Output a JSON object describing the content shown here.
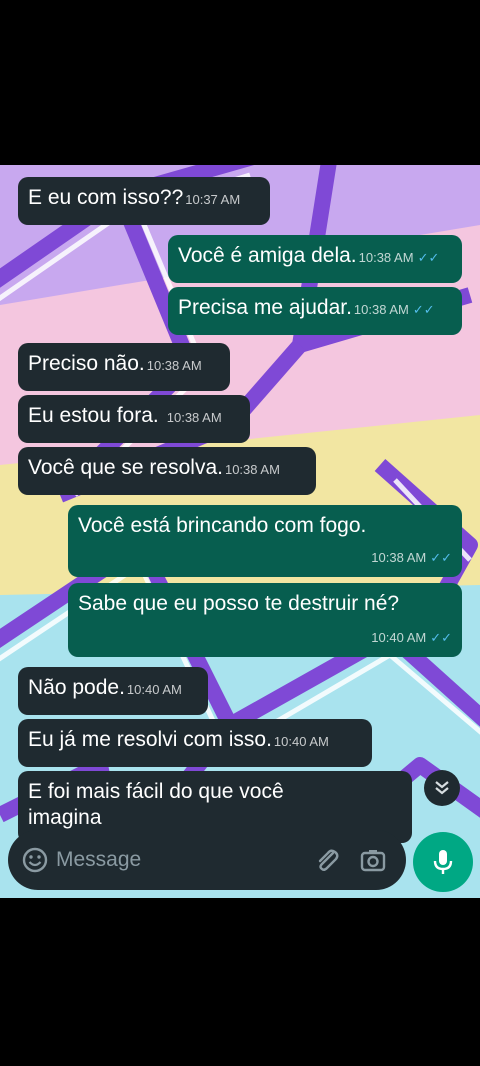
{
  "messages": [
    {
      "text": "E eu com isso??",
      "time": "10:37 AM"
    },
    {
      "text": "Você é amiga dela.",
      "time": "10:38 AM"
    },
    {
      "text": "Precisa me ajudar.",
      "time": "10:38 AM"
    },
    {
      "text": "Preciso não.",
      "time": "10:38 AM"
    },
    {
      "text": "Eu estou fora.",
      "time": "10:38 AM"
    },
    {
      "text": "Você que se resolva.",
      "time": "10:38 AM"
    },
    {
      "text": "Você está brincando com fogo.",
      "time": "10:38 AM"
    },
    {
      "text": "Sabe que eu posso te destruir né?",
      "time": "10:40 AM"
    },
    {
      "text": "Não pode.",
      "time": "10:40 AM"
    },
    {
      "text": "Eu já me resolvi com isso.",
      "time": "10:40 AM"
    },
    {
      "text": "E foi mais fácil do que você",
      "line2": "imagina"
    }
  ],
  "input": {
    "placeholder": "Message"
  },
  "icons": [
    "emoji-icon",
    "attach-icon",
    "camera-icon",
    "mic-icon",
    "chevron-double-down-icon",
    "double-check-icon"
  ],
  "colors": {
    "incoming": "#1f2a30",
    "outgoing": "#075e4f",
    "read_tick": "#53bdeb",
    "mic_button": "#00a884"
  }
}
